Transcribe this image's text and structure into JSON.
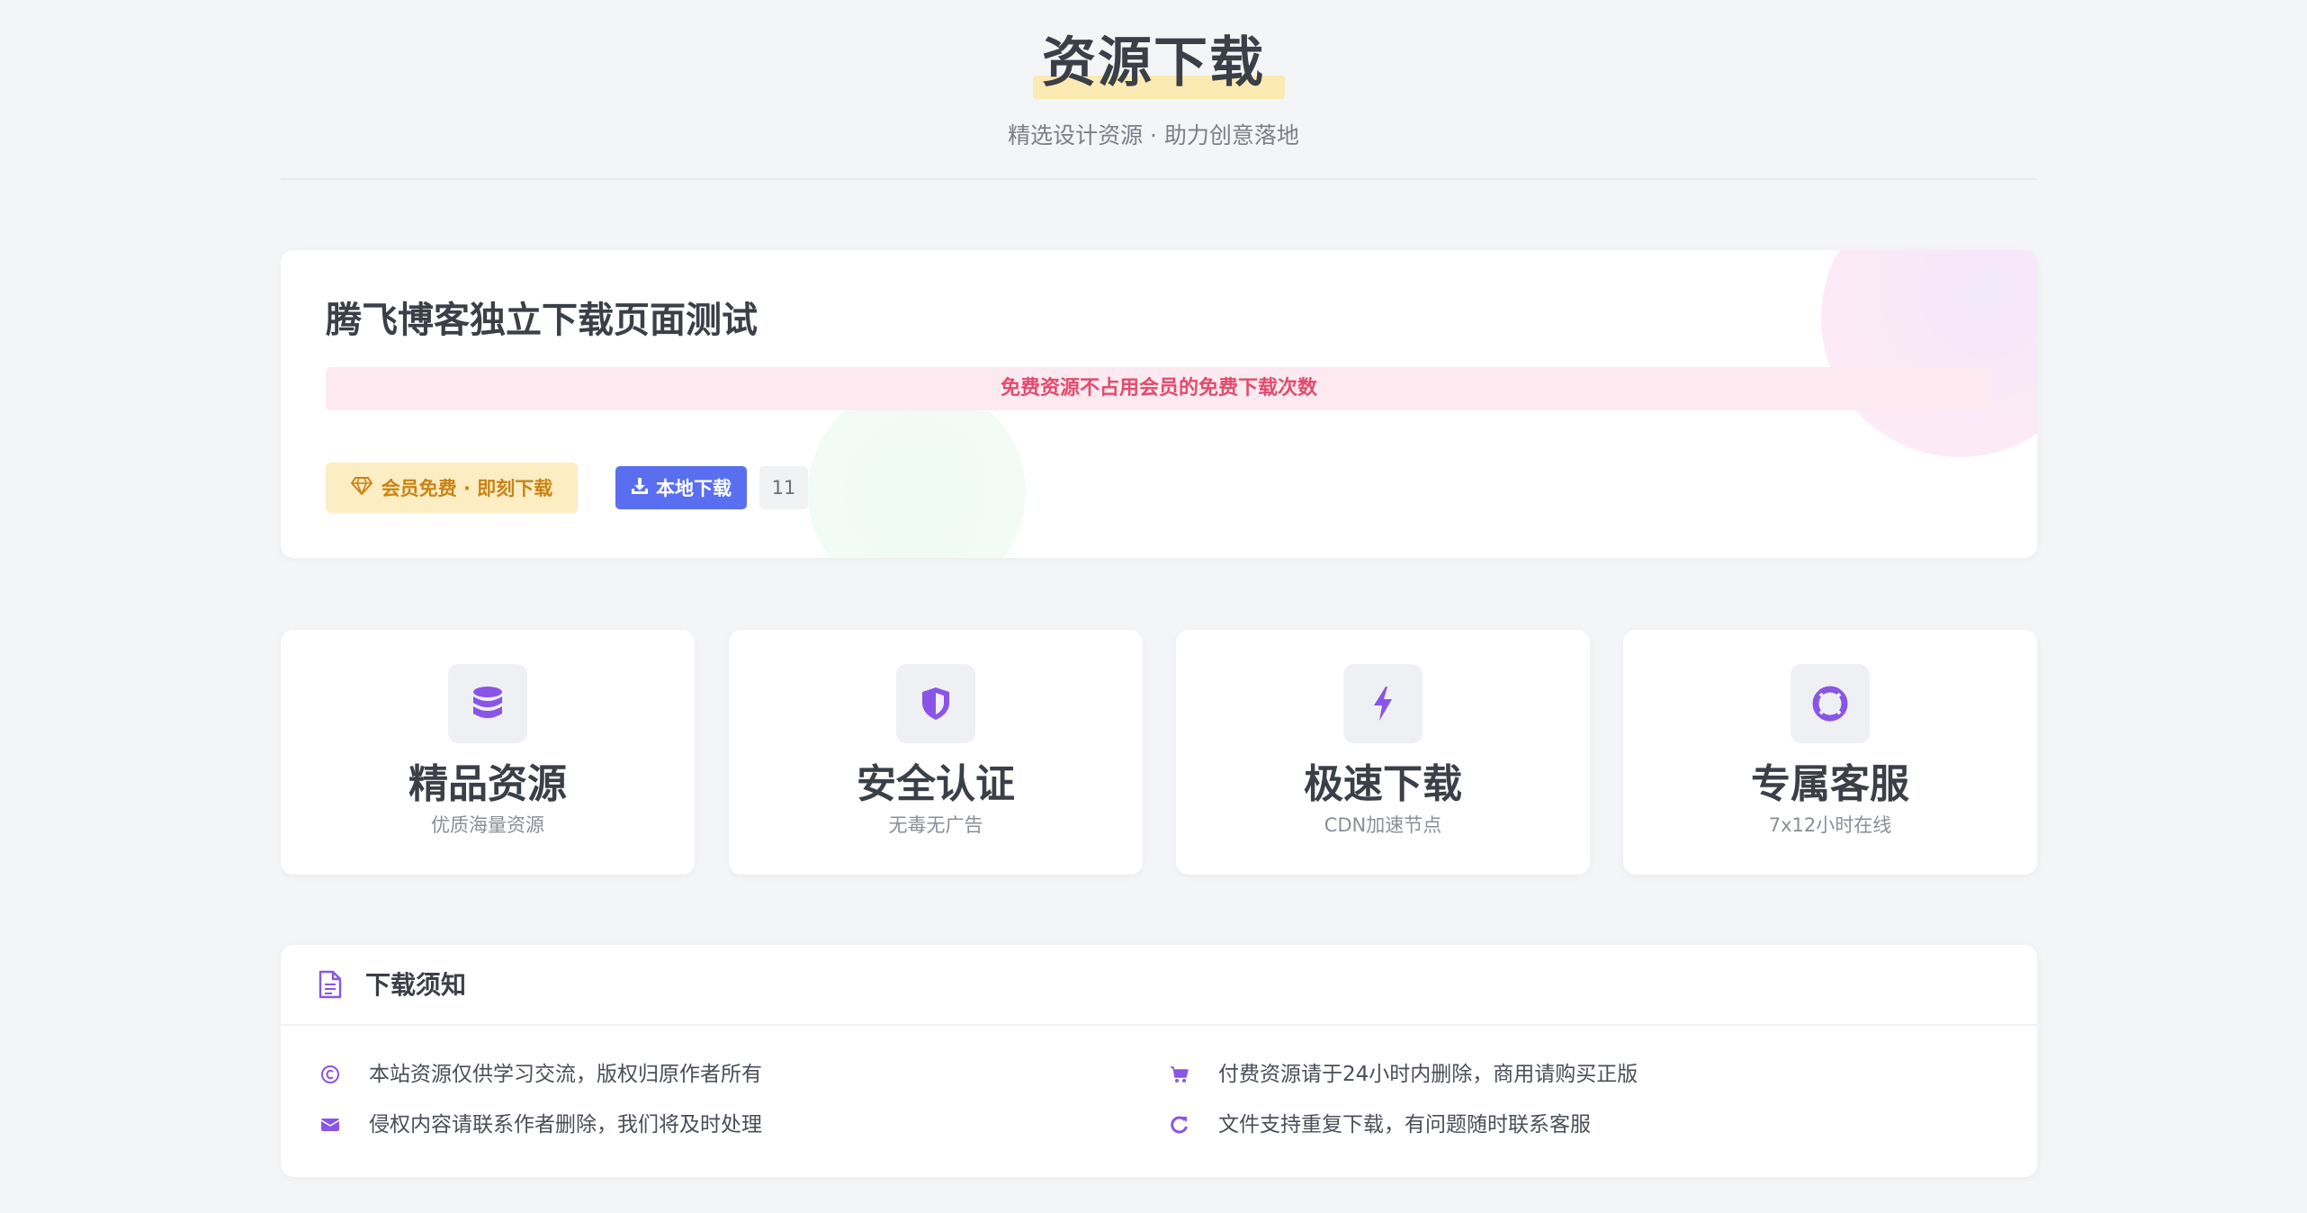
{
  "header": {
    "title": "资源下载",
    "subtitle": "精选设计资源 · 助力创意落地"
  },
  "resource": {
    "title": "腾飞博客独立下载页面测试",
    "notice": "免费资源不占用会员的免费下载次数",
    "vip_button_label": "会员免费 · 即刻下载",
    "download_button_label": "本地下载",
    "download_count": "11"
  },
  "features": [
    {
      "icon": "database-icon",
      "title": "精品资源",
      "desc": "优质海量资源"
    },
    {
      "icon": "shield-icon",
      "title": "安全认证",
      "desc": "无毒无广告"
    },
    {
      "icon": "lightning-icon",
      "title": "极速下载",
      "desc": "CDN加速节点"
    },
    {
      "icon": "lifebuoy-icon",
      "title": "专属客服",
      "desc": "7x12小时在线"
    }
  ],
  "download_notice": {
    "title": "下载须知",
    "items": [
      {
        "icon": "copyright-icon",
        "text": "本站资源仅供学习交流，版权归原作者所有"
      },
      {
        "icon": "cart-icon",
        "text": "付费资源请于24小时内删除，商用请购买正版"
      },
      {
        "icon": "envelope-icon",
        "text": "侵权内容请联系作者删除，我们将及时处理"
      },
      {
        "icon": "refresh-icon",
        "text": "文件支持重复下载，有问题随时联系客服"
      }
    ]
  },
  "colors": {
    "accent_purple": "#8a55e6",
    "download_blue": "#5a6ff0",
    "vip_gold": "#c98316",
    "notice_red": "#e24b6e"
  }
}
